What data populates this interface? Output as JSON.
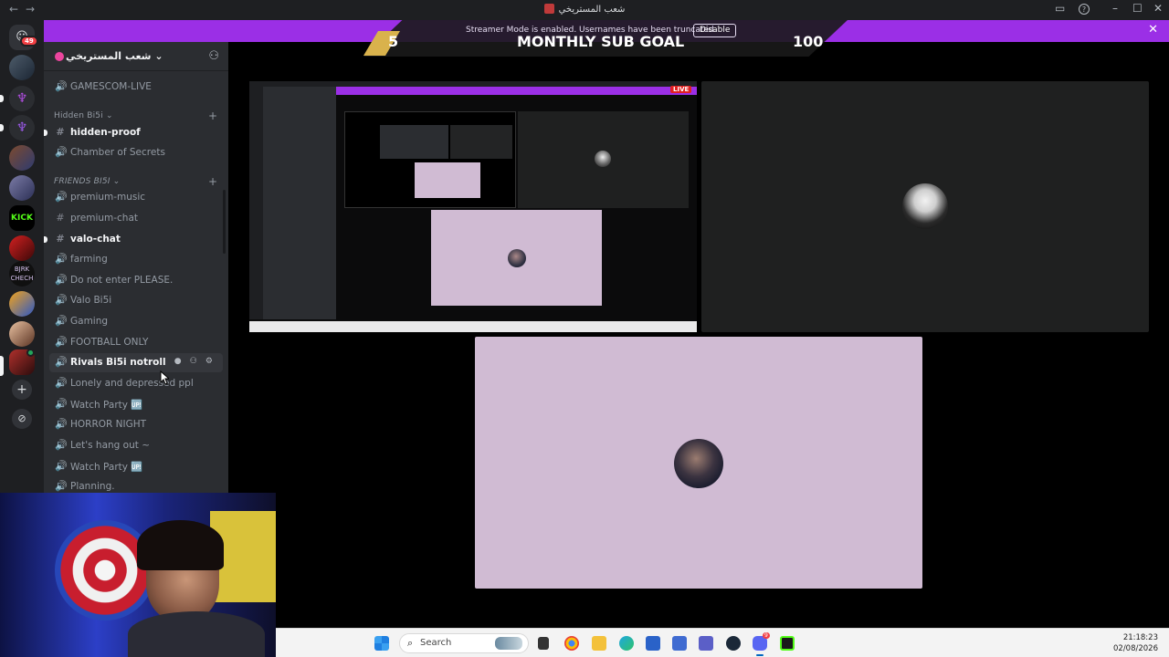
{
  "window": {
    "title": "شعب المستريخي",
    "back": "←",
    "forward": "→",
    "controls": {
      "inbox": "▭",
      "help": "?",
      "minimize": "–",
      "maximize": "☐",
      "close": "✕"
    }
  },
  "rail": {
    "dm_badge": "49",
    "kick_label": "KICK",
    "add_server": "+",
    "discover": "⊘"
  },
  "server": {
    "name": "شعب المستريخي",
    "chevron": "⌄",
    "invite_icon": "⚇"
  },
  "channels_top": [
    {
      "type": "voice",
      "label": "GAMESCOM-LIVE",
      "state": "normal"
    }
  ],
  "categories": [
    {
      "label": "Hidden Bi5i ⌄",
      "add": "+"
    },
    {
      "label": "FRIENDS BI5I ⌄",
      "add": "+"
    }
  ],
  "hidden_channels": [
    {
      "type": "text",
      "label": "hidden-proof",
      "state": "unread"
    },
    {
      "type": "voice",
      "label": "Chamber of Secrets",
      "state": "normal"
    }
  ],
  "friends_channels": [
    {
      "type": "voice",
      "label": "premium-music",
      "state": "normal"
    },
    {
      "type": "text",
      "label": "premium-chat",
      "state": "normal"
    },
    {
      "type": "text",
      "label": "valo-chat",
      "state": "unread"
    },
    {
      "type": "voice",
      "label": "farming",
      "state": "normal"
    },
    {
      "type": "voice",
      "label": "Do not enter PLEASE.",
      "state": "normal"
    },
    {
      "type": "voice",
      "label": "Valo Bi5i",
      "state": "normal"
    },
    {
      "type": "voice",
      "label": "Gaming",
      "state": "normal"
    },
    {
      "type": "voice",
      "label": "FOOTBALL ONLY",
      "state": "normal"
    },
    {
      "type": "voice",
      "label": "Rivals Bi5i notroll",
      "state": "hover"
    },
    {
      "type": "voice",
      "label": "Lonely and depressed ppl",
      "state": "normal"
    },
    {
      "type": "voice",
      "label": "Watch Party 🆙",
      "state": "normal"
    },
    {
      "type": "voice",
      "label": "HORROR NIGHT",
      "state": "normal"
    },
    {
      "type": "voice",
      "label": "Let's hang out ~",
      "state": "normal"
    },
    {
      "type": "voice",
      "label": "Watch Party 🆙",
      "state": "normal"
    },
    {
      "type": "voice",
      "label": "Planning.",
      "state": "normal"
    }
  ],
  "channel_tools": "● ⚇ ⚙",
  "banner": {
    "notice": "Streamer Mode is enabled. Usernames have been truncated.",
    "disable": "Disable",
    "close": "✕"
  },
  "subgoal": {
    "current": "5",
    "label": "MONTHLY SUB GOAL",
    "target": "100"
  },
  "mini_screen": {
    "live_badge": "LIVE"
  },
  "taskbar": {
    "search": "Search",
    "time": "21:18:23",
    "date": "02/08/2026",
    "discord_badge": "9"
  },
  "colors": {
    "banner": "#9b2fe6",
    "tile_pink": "#d0bbd3",
    "tile_dark": "#1f2020",
    "sidebar": "#2b2d31"
  }
}
